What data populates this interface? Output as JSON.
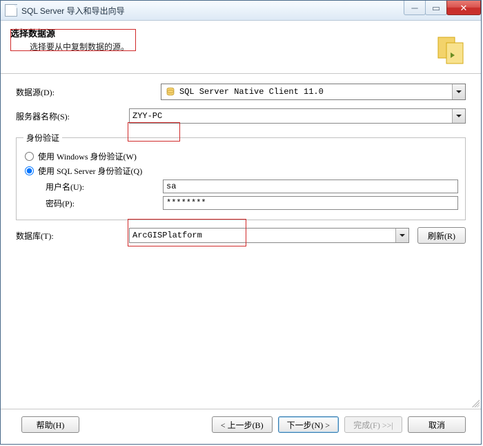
{
  "window": {
    "title": "SQL Server 导入和导出向导"
  },
  "header": {
    "heading": "选择数据源",
    "subheading": "选择要从中复制数据的源。"
  },
  "form": {
    "datasource_label": "数据源(D):",
    "datasource_value": "SQL Server Native Client 11.0",
    "server_label": "服务器名称(S):",
    "server_value": "ZYY-PC",
    "auth_legend": "身份验证",
    "auth_windows": "使用 Windows 身份验证(W)",
    "auth_sql": "使用 SQL Server 身份验证(Q)",
    "user_label": "用户名(U):",
    "user_value": "sa",
    "password_label": "密码(P):",
    "password_value": "********",
    "database_label": "数据库(T):",
    "database_value": "ArcGISPlatform",
    "refresh_label": "刷新(R)"
  },
  "footer": {
    "help": "帮助(H)",
    "back": "< 上一步(B)",
    "next": "下一步(N) >",
    "finish": "完成(F) >>|",
    "cancel": "取消"
  }
}
